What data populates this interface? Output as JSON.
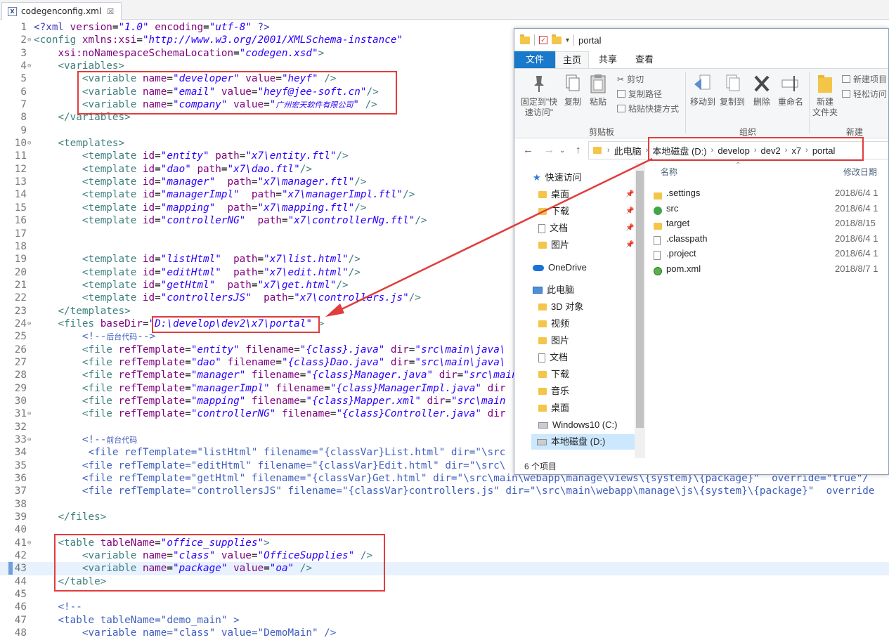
{
  "editor": {
    "tab_title": "codegenconfig.xml",
    "tab_close": "☒",
    "lines": [
      {
        "n": "1",
        "fold": "",
        "html": "<span class='pi'>&lt;?xml</span> <span class='attr'>version</span>=<span class='val'>\"1.0\"</span> <span class='attr'>encoding</span>=<span class='val'>\"utf-8\"</span> <span class='pi'>?&gt;</span>"
      },
      {
        "n": "2",
        "fold": "⊖",
        "html": "<span class='tag'>&lt;config</span> <span class='attr'>xmlns:xsi</span>=<span class='val'>\"http://www.w3.org/2001/XMLSchema-instance\"</span>"
      },
      {
        "n": "3",
        "fold": "",
        "html": "    <span class='attr'>xsi:noNamespaceSchemaLocation</span>=<span class='val'>\"codegen.xsd\"</span><span class='tag'>&gt;</span>"
      },
      {
        "n": "4",
        "fold": "⊖",
        "html": "    <span class='tag'>&lt;variables&gt;</span>"
      },
      {
        "n": "5",
        "fold": "",
        "html": "        <span class='tag'>&lt;variable</span> <span class='attr'>name</span>=<span class='val'>\"developer\"</span> <span class='attr'>value</span>=<span class='val'>\"heyf\"</span> <span class='tag'>/&gt;</span>"
      },
      {
        "n": "6",
        "fold": "",
        "html": "        <span class='tag'>&lt;variable</span> <span class='attr'>name</span>=<span class='val'>\"email\"</span> <span class='attr'>value</span>=<span class='val'>\"heyf@jee-soft.cn\"</span><span class='tag'>/&gt;</span>"
      },
      {
        "n": "7",
        "fold": "",
        "html": "        <span class='tag'>&lt;variable</span> <span class='attr'>name</span>=<span class='val'>\"company\"</span> <span class='attr'>value</span>=<span class='val'>\"<span class='cn-it'>广州宏天软件有限公司</span>\"</span> <span class='tag'>/&gt;</span>"
      },
      {
        "n": "8",
        "fold": "",
        "html": "    <span class='tag'>&lt;/variables&gt;</span>"
      },
      {
        "n": "9",
        "fold": "",
        "html": ""
      },
      {
        "n": "10",
        "fold": "⊖",
        "html": "    <span class='tag'>&lt;templates&gt;</span>"
      },
      {
        "n": "11",
        "fold": "",
        "html": "        <span class='tag'>&lt;template</span> <span class='attr'>id</span>=<span class='val'>\"entity\"</span> <span class='attr'>path</span>=<span class='val'>\"x7\\entity.ftl\"</span><span class='tag'>/&gt;</span>"
      },
      {
        "n": "12",
        "fold": "",
        "html": "        <span class='tag'>&lt;template</span> <span class='attr'>id</span>=<span class='val'>\"dao\"</span> <span class='attr'>path</span>=<span class='val'>\"x7\\dao.ftl\"</span><span class='tag'>/&gt;</span>"
      },
      {
        "n": "13",
        "fold": "",
        "html": "        <span class='tag'>&lt;template</span> <span class='attr'>id</span>=<span class='val'>\"manager\"</span>  <span class='attr'>path</span>=<span class='val'>\"x7\\manager.ftl\"</span><span class='tag'>/&gt;</span>"
      },
      {
        "n": "14",
        "fold": "",
        "html": "        <span class='tag'>&lt;template</span> <span class='attr'>id</span>=<span class='val'>\"managerImpl\"</span>  <span class='attr'>path</span>=<span class='val'>\"x7\\managerImpl.ftl\"</span><span class='tag'>/&gt;</span>"
      },
      {
        "n": "15",
        "fold": "",
        "html": "        <span class='tag'>&lt;template</span> <span class='attr'>id</span>=<span class='val'>\"mapping\"</span>  <span class='attr'>path</span>=<span class='val'>\"x7\\mapping.ftl\"</span><span class='tag'>/&gt;</span>"
      },
      {
        "n": "16",
        "fold": "",
        "html": "        <span class='tag'>&lt;template</span> <span class='attr'>id</span>=<span class='val'>\"controllerNG\"</span>  <span class='attr'>path</span>=<span class='val'>\"x7\\controllerNg.ftl\"</span><span class='tag'>/&gt;</span>"
      },
      {
        "n": "17",
        "fold": "",
        "html": ""
      },
      {
        "n": "18",
        "fold": "",
        "html": ""
      },
      {
        "n": "19",
        "fold": "",
        "html": "        <span class='tag'>&lt;template</span> <span class='attr'>id</span>=<span class='val'>\"listHtml\"</span>  <span class='attr'>path</span>=<span class='val'>\"x7\\list.html\"</span><span class='tag'>/&gt;</span>"
      },
      {
        "n": "20",
        "fold": "",
        "html": "        <span class='tag'>&lt;template</span> <span class='attr'>id</span>=<span class='val'>\"editHtml\"</span>  <span class='attr'>path</span>=<span class='val'>\"x7\\edit.html\"</span><span class='tag'>/&gt;</span>"
      },
      {
        "n": "21",
        "fold": "",
        "html": "        <span class='tag'>&lt;template</span> <span class='attr'>id</span>=<span class='val'>\"getHtml\"</span>  <span class='attr'>path</span>=<span class='val'>\"x7\\get.html\"</span><span class='tag'>/&gt;</span>"
      },
      {
        "n": "22",
        "fold": "",
        "html": "        <span class='tag'>&lt;template</span> <span class='attr'>id</span>=<span class='val'>\"controllersJS\"</span>  <span class='attr'>path</span>=<span class='val'>\"x7\\controllers.js\"</span><span class='tag'>/&gt;</span>"
      },
      {
        "n": "23",
        "fold": "",
        "html": "    <span class='tag'>&lt;/templates&gt;</span>"
      },
      {
        "n": "24",
        "fold": "⊖",
        "html": "    <span class='tag'>&lt;files</span> <span class='attr'>baseDir</span>=<span class='val'>\"D:\\develop\\dev2\\x7\\portal\"</span> <span class='tag'>&gt;</span>"
      },
      {
        "n": "25",
        "fold": "",
        "html": "        <span class='cmt'>&lt;!--<span class='cn'>后台代码</span>--&gt;</span>"
      },
      {
        "n": "26",
        "fold": "",
        "html": "        <span class='tag'>&lt;file</span> <span class='attr'>refTemplate</span>=<span class='val'>\"entity\"</span> <span class='attr'>filename</span>=<span class='val'>\"{class}.java\"</span> <span class='attr'>dir</span>=<span class='val'>\"src\\main\\java\\</span>"
      },
      {
        "n": "27",
        "fold": "",
        "html": "        <span class='tag'>&lt;file</span> <span class='attr'>refTemplate</span>=<span class='val'>\"dao\"</span> <span class='attr'>filename</span>=<span class='val'>\"{class}Dao.java\"</span> <span class='attr'>dir</span>=<span class='val'>\"src\\main\\java\\</span>"
      },
      {
        "n": "28",
        "fold": "",
        "html": "        <span class='tag'>&lt;file</span> <span class='attr'>refTemplate</span>=<span class='val'>\"manager\"</span> <span class='attr'>filename</span>=<span class='val'>\"{class}Manager.java\"</span> <span class='attr'>dir</span>=<span class='val'>\"src\\main</span>"
      },
      {
        "n": "29",
        "fold": "",
        "html": "        <span class='tag'>&lt;file</span> <span class='attr'>refTemplate</span>=<span class='val'>\"managerImpl\"</span> <span class='attr'>filename</span>=<span class='val'>\"{class}ManagerImpl.java\"</span> <span class='attr'>dir</span>"
      },
      {
        "n": "30",
        "fold": "",
        "html": "        <span class='tag'>&lt;file</span> <span class='attr'>refTemplate</span>=<span class='val'>\"mapping\"</span> <span class='attr'>filename</span>=<span class='val'>\"{class}Mapper.xml\"</span> <span class='attr'>dir</span>=<span class='val'>\"src\\main</span>"
      },
      {
        "n": "31",
        "fold": "⊖",
        "html": "        <span class='tag'>&lt;file</span> <span class='attr'>refTemplate</span>=<span class='val'>\"controllerNG\"</span> <span class='attr'>filename</span>=<span class='val'>\"{class}Controller.java\"</span> <span class='attr'>dir</span>"
      },
      {
        "n": "32",
        "fold": "",
        "html": ""
      },
      {
        "n": "33",
        "fold": "⊖",
        "html": "        <span class='cmt'>&lt;!--<span class='cn'>前台代码</span></span>"
      },
      {
        "n": "34",
        "fold": "",
        "html": "         <span class='cmt'>&lt;file refTemplate=\"listHtml\" filename=\"{classVar}List.html\" dir=\"\\src</span>"
      },
      {
        "n": "35",
        "fold": "",
        "html": "        <span class='cmt'>&lt;file refTemplate=\"editHtml\" filename=\"{classVar}Edit.html\" dir=\"\\src\\</span>"
      },
      {
        "n": "36",
        "fold": "",
        "html": "        <span class='cmt'>&lt;file refTemplate=\"getHtml\" filename=\"{classVar}Get.html\" dir=\"\\src\\main\\webapp\\manage\\views\\{system}\\{package}\"  override=\"true\"/</span>"
      },
      {
        "n": "37",
        "fold": "",
        "html": "        <span class='cmt'>&lt;file refTemplate=\"controllersJS\" filename=\"{classVar}controllers.js\" dir=\"\\src\\main\\webapp\\manage\\js\\{system}\\{package}\"  override</span>"
      },
      {
        "n": "38",
        "fold": "",
        "html": ""
      },
      {
        "n": "39",
        "fold": "",
        "html": "    <span class='tag'>&lt;/files&gt;</span>"
      },
      {
        "n": "40",
        "fold": "",
        "html": ""
      },
      {
        "n": "41",
        "fold": "⊖",
        "html": "    <span class='tag'>&lt;table</span> <span class='attr'>tableName</span>=<span class='val'>\"office_supplies\"</span><span class='tag'>&gt;</span>"
      },
      {
        "n": "42",
        "fold": "",
        "html": "        <span class='tag'>&lt;variable</span> <span class='attr'>name</span>=<span class='val'>\"class\"</span> <span class='attr'>value</span>=<span class='val'>\"OfficeSupplies\"</span> <span class='tag'>/&gt;</span>"
      },
      {
        "n": "43",
        "fold": "",
        "html": "        <span class='tag'>&lt;variable</span> <span class='attr'>name</span>=<span class='val'>\"package\"</span> <span class='attr'>value</span>=<span class='val'>\"oa\"</span> <span class='tag'>/&gt;</span>"
      },
      {
        "n": "44",
        "fold": "",
        "html": "    <span class='tag'>&lt;/table&gt;</span>"
      },
      {
        "n": "45",
        "fold": "",
        "html": ""
      },
      {
        "n": "46",
        "fold": "",
        "html": "    <span class='cmt'>&lt;!--</span>"
      },
      {
        "n": "47",
        "fold": "",
        "html": "    <span class='cmt'>&lt;table tableName=\"demo_main\" &gt;</span>"
      },
      {
        "n": "48",
        "fold": "",
        "html": "        <span class='cmt'>&lt;variable name=\"class\" value=\"DemoMain\" /&gt;</span>"
      }
    ]
  },
  "explorer": {
    "title": "portal",
    "qa_dropdown": "▾",
    "tabs": {
      "file": "文件",
      "home": "主页",
      "share": "共享",
      "view": "查看"
    },
    "ribbon": {
      "pin": "固定到\"快速访问\"",
      "copy": "复制",
      "paste": "粘贴",
      "cut": "剪切",
      "copy_path": "复制路径",
      "paste_shortcut": "粘贴快捷方式",
      "move_to": "移动到",
      "copy_to": "复制到",
      "delete": "删除",
      "rename": "重命名",
      "new_folder": "新建\n文件夹",
      "new_item": "新建项目",
      "easy_access": "轻松访问",
      "group_clipboard": "剪贴板",
      "group_organize": "组织",
      "group_new": "新建"
    },
    "address": {
      "this_pc": "此电脑",
      "crumbs": [
        "本地磁盘 (D:)",
        "develop",
        "dev2",
        "x7",
        "portal"
      ]
    },
    "nav": [
      {
        "label": "快速访问",
        "kind": "star",
        "indent": 0
      },
      {
        "label": "桌面",
        "kind": "folder",
        "indent": 1,
        "pin": true
      },
      {
        "label": "下载",
        "kind": "folder",
        "indent": 1,
        "pin": true
      },
      {
        "label": "文档",
        "kind": "doc",
        "indent": 1,
        "pin": true
      },
      {
        "label": "图片",
        "kind": "folder",
        "indent": 1,
        "pin": true
      },
      {
        "label": "OneDrive",
        "kind": "cloud",
        "indent": 0
      },
      {
        "label": "此电脑",
        "kind": "pc",
        "indent": 0
      },
      {
        "label": "3D 对象",
        "kind": "folder",
        "indent": 1
      },
      {
        "label": "视频",
        "kind": "folder",
        "indent": 1
      },
      {
        "label": "图片",
        "kind": "folder",
        "indent": 1
      },
      {
        "label": "文档",
        "kind": "doc",
        "indent": 1
      },
      {
        "label": "下载",
        "kind": "folder",
        "indent": 1
      },
      {
        "label": "音乐",
        "kind": "folder",
        "indent": 1
      },
      {
        "label": "桌面",
        "kind": "folder",
        "indent": 1
      },
      {
        "label": "Windows10 (C:)",
        "kind": "drive",
        "indent": 1
      },
      {
        "label": "本地磁盘 (D:)",
        "kind": "drive",
        "indent": 1,
        "selected": true
      }
    ],
    "columns": {
      "name": "名称",
      "date": "修改日期"
    },
    "files": [
      {
        "name": ".settings",
        "date": "2018/6/4 1",
        "kind": "folder"
      },
      {
        "name": "src",
        "date": "2018/6/4 1",
        "kind": "src"
      },
      {
        "name": "target",
        "date": "2018/8/15",
        "kind": "folder"
      },
      {
        "name": ".classpath",
        "date": "2018/6/4 1",
        "kind": "doc"
      },
      {
        "name": ".project",
        "date": "2018/6/4 1",
        "kind": "doc"
      },
      {
        "name": "pom.xml",
        "date": "2018/8/7 1",
        "kind": "pom"
      }
    ],
    "status": "6 个项目"
  },
  "colors": {
    "highlight": "#e23c3c",
    "ribbon_file": "#1979ca"
  }
}
